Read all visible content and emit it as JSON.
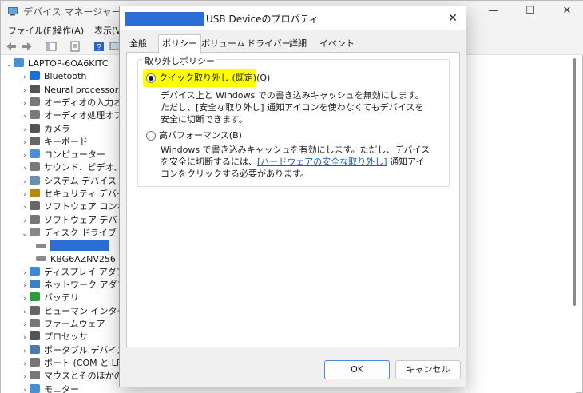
{
  "device_manager": {
    "title": "デバイス マネージャー",
    "window_controls": {
      "minimize": "—",
      "maximize": "☐",
      "close": "✕"
    },
    "menu": [
      "ファイル(F)",
      "操作(A)",
      "表示(V"
    ],
    "tree": {
      "root": "LAPTOP-6OA6KITC",
      "items": [
        {
          "label": "Bluetooth",
          "expanded": false
        },
        {
          "label": "Neural processors",
          "expanded": false
        },
        {
          "label": "オーディオの入力およ",
          "expanded": false
        },
        {
          "label": "オーディオ処理オブジ",
          "expanded": false
        },
        {
          "label": "カメラ",
          "expanded": false
        },
        {
          "label": "キーボード",
          "expanded": false
        },
        {
          "label": "コンピューター",
          "expanded": false
        },
        {
          "label": "サウンド、ビデオ、およ",
          "expanded": false
        },
        {
          "label": "システム デバイス",
          "expanded": false
        },
        {
          "label": "セキュリティ デバイス",
          "expanded": false
        },
        {
          "label": "ソフトウェア コンポーネ",
          "expanded": false
        },
        {
          "label": "ソフトウェア デバイス",
          "expanded": false
        },
        {
          "label": "ディスク ドライブ",
          "expanded": true
        },
        {
          "label": "",
          "child": true,
          "redacted": true
        },
        {
          "label": "KBG6AZNV256",
          "child": true
        },
        {
          "label": "ディスプレイ アダプター",
          "expanded": false
        },
        {
          "label": "ネットワーク アダプター",
          "expanded": false
        },
        {
          "label": "バッテリ",
          "expanded": false
        },
        {
          "label": "ヒューマン インターフェ",
          "expanded": false
        },
        {
          "label": "ファームウェア",
          "expanded": false
        },
        {
          "label": "プロセッサ",
          "expanded": false
        },
        {
          "label": "ポータブル デバイス",
          "expanded": false
        },
        {
          "label": "ポート (COM と LPT)",
          "expanded": false
        },
        {
          "label": "マウスとそのほかのポ",
          "expanded": false
        },
        {
          "label": "モニター",
          "expanded": false
        }
      ]
    }
  },
  "dialog": {
    "title": "USB Deviceのプロパティ",
    "close": "✕",
    "tabs": [
      "全般",
      "ポリシー",
      "ボリューム",
      "ドライバー",
      "詳細",
      "イベント"
    ],
    "active_tab": "ポリシー",
    "group_label": "取り外しポリシー",
    "options": [
      {
        "label": "クイック取り外し (既定)(Q)",
        "checked": true,
        "highlighted": true,
        "description": "デバイス上と Windows での書き込みキャッシュを無効にします。ただし、[安全な取り外し] 通知アイコンを使わなくてもデバイスを安全に切断できます。"
      },
      {
        "label": "高パフォーマンス(B)",
        "checked": false,
        "description_before": "Windows で書き込みキャッシュを有効にします。ただし、デバイスを安全に切断するには、",
        "description_link": "[ハードウェアの安全な取り外し]",
        "description_after": " 通知アイコンをクリックする必要があります。"
      }
    ],
    "buttons": {
      "ok": "OK",
      "cancel": "キャンセル"
    }
  },
  "colors": {
    "highlight": "#ffff00",
    "redaction": "#2b6fd6",
    "link": "#1a5fb4"
  }
}
